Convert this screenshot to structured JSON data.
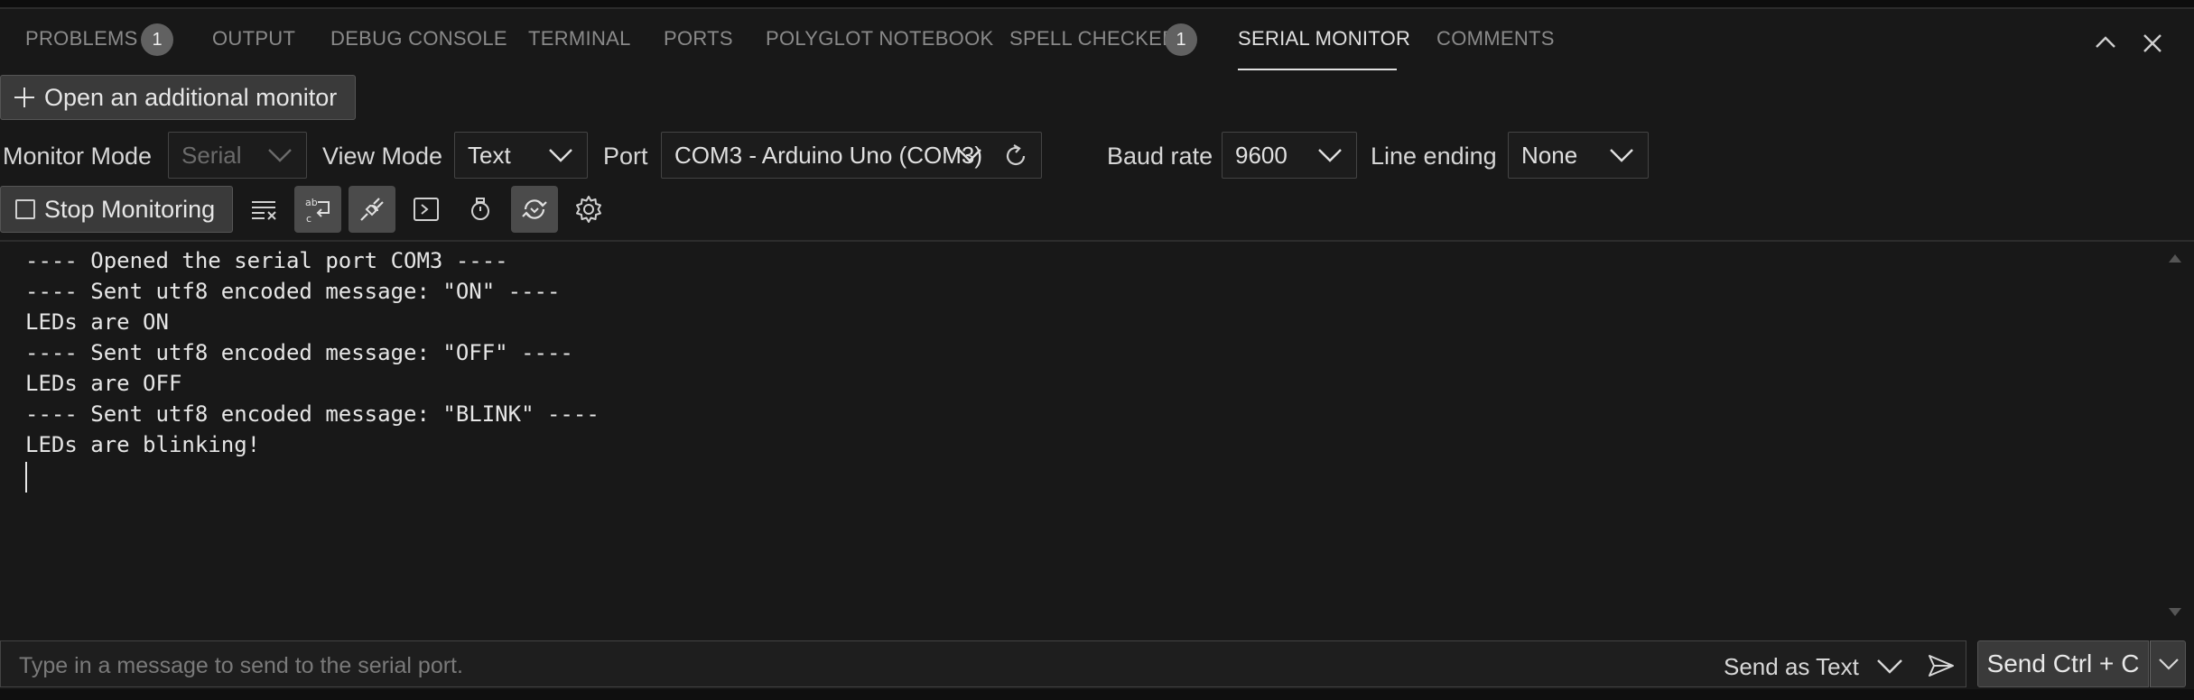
{
  "tabs": [
    {
      "label": "PROBLEMS",
      "badge": "1"
    },
    {
      "label": "OUTPUT"
    },
    {
      "label": "DEBUG CONSOLE"
    },
    {
      "label": "TERMINAL"
    },
    {
      "label": "PORTS"
    },
    {
      "label": "POLYGLOT NOTEBOOK"
    },
    {
      "label": "SPELL CHECKER",
      "badge": "1"
    },
    {
      "label": "SERIAL MONITOR",
      "active": true
    },
    {
      "label": "COMMENTS"
    }
  ],
  "open_monitor": {
    "label": "Open an additional monitor"
  },
  "settings": {
    "monitor_mode": {
      "label": "Monitor Mode",
      "value": "Serial"
    },
    "view_mode": {
      "label": "View Mode",
      "value": "Text"
    },
    "port": {
      "label": "Port",
      "value": "COM3 - Arduino Uno (COM3)"
    },
    "baud_rate": {
      "label": "Baud rate",
      "value": "9600"
    },
    "line_ending": {
      "label": "Line ending",
      "value": "None"
    }
  },
  "toolbar": {
    "stop_label": "Stop Monitoring"
  },
  "output_lines": [
    "---- Opened the serial port COM3 ----",
    "---- Sent utf8 encoded message: \"ON\" ----",
    "LEDs are ON",
    "---- Sent utf8 encoded message: \"OFF\" ----",
    "LEDs are OFF",
    "---- Sent utf8 encoded message: \"BLINK\" ----",
    "LEDs are blinking!"
  ],
  "send": {
    "placeholder": "Type in a message to send to the serial port.",
    "mode": "Send as Text",
    "shortcut_label": "Send Ctrl + C"
  },
  "icons": {
    "clear": "clear-output-icon",
    "word_wrap": "word-wrap-icon",
    "plug": "plug-icon",
    "terminal": "terminal-icon",
    "timestamp": "stopwatch-icon",
    "autoscroll": "autoscroll-icon",
    "settings": "gear-icon",
    "refresh": "refresh-icon",
    "send": "send-arrow-icon"
  },
  "colors": {
    "background": "#181818",
    "active_toggle": "#4b4b4b",
    "badge": "#616161"
  }
}
